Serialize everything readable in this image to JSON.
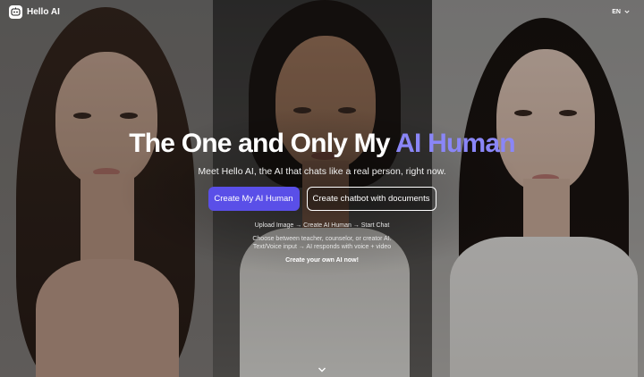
{
  "header": {
    "brand": "Hello AI",
    "language": "EN"
  },
  "hero": {
    "title_main": "The One and Only My ",
    "title_accent": "AI Human",
    "subtitle": "Meet Hello AI, the AI that chats like a real person, right now.",
    "accent_color": "#8a86f7"
  },
  "buttons": {
    "primary": "Create My AI Human",
    "secondary": "Create chatbot with documents",
    "primary_color": "#5a4fe8"
  },
  "info": {
    "steps": "Upload Image → Create AI Human → Start Chat",
    "line1": "Choose between teacher, counselor, or creator AI.",
    "line2": "Text/Voice input → AI responds with voice + video",
    "cta": "Create your own AI now!"
  },
  "icons": [
    "logo-icon",
    "chevron-down-icon",
    "scroll-down-icon"
  ]
}
